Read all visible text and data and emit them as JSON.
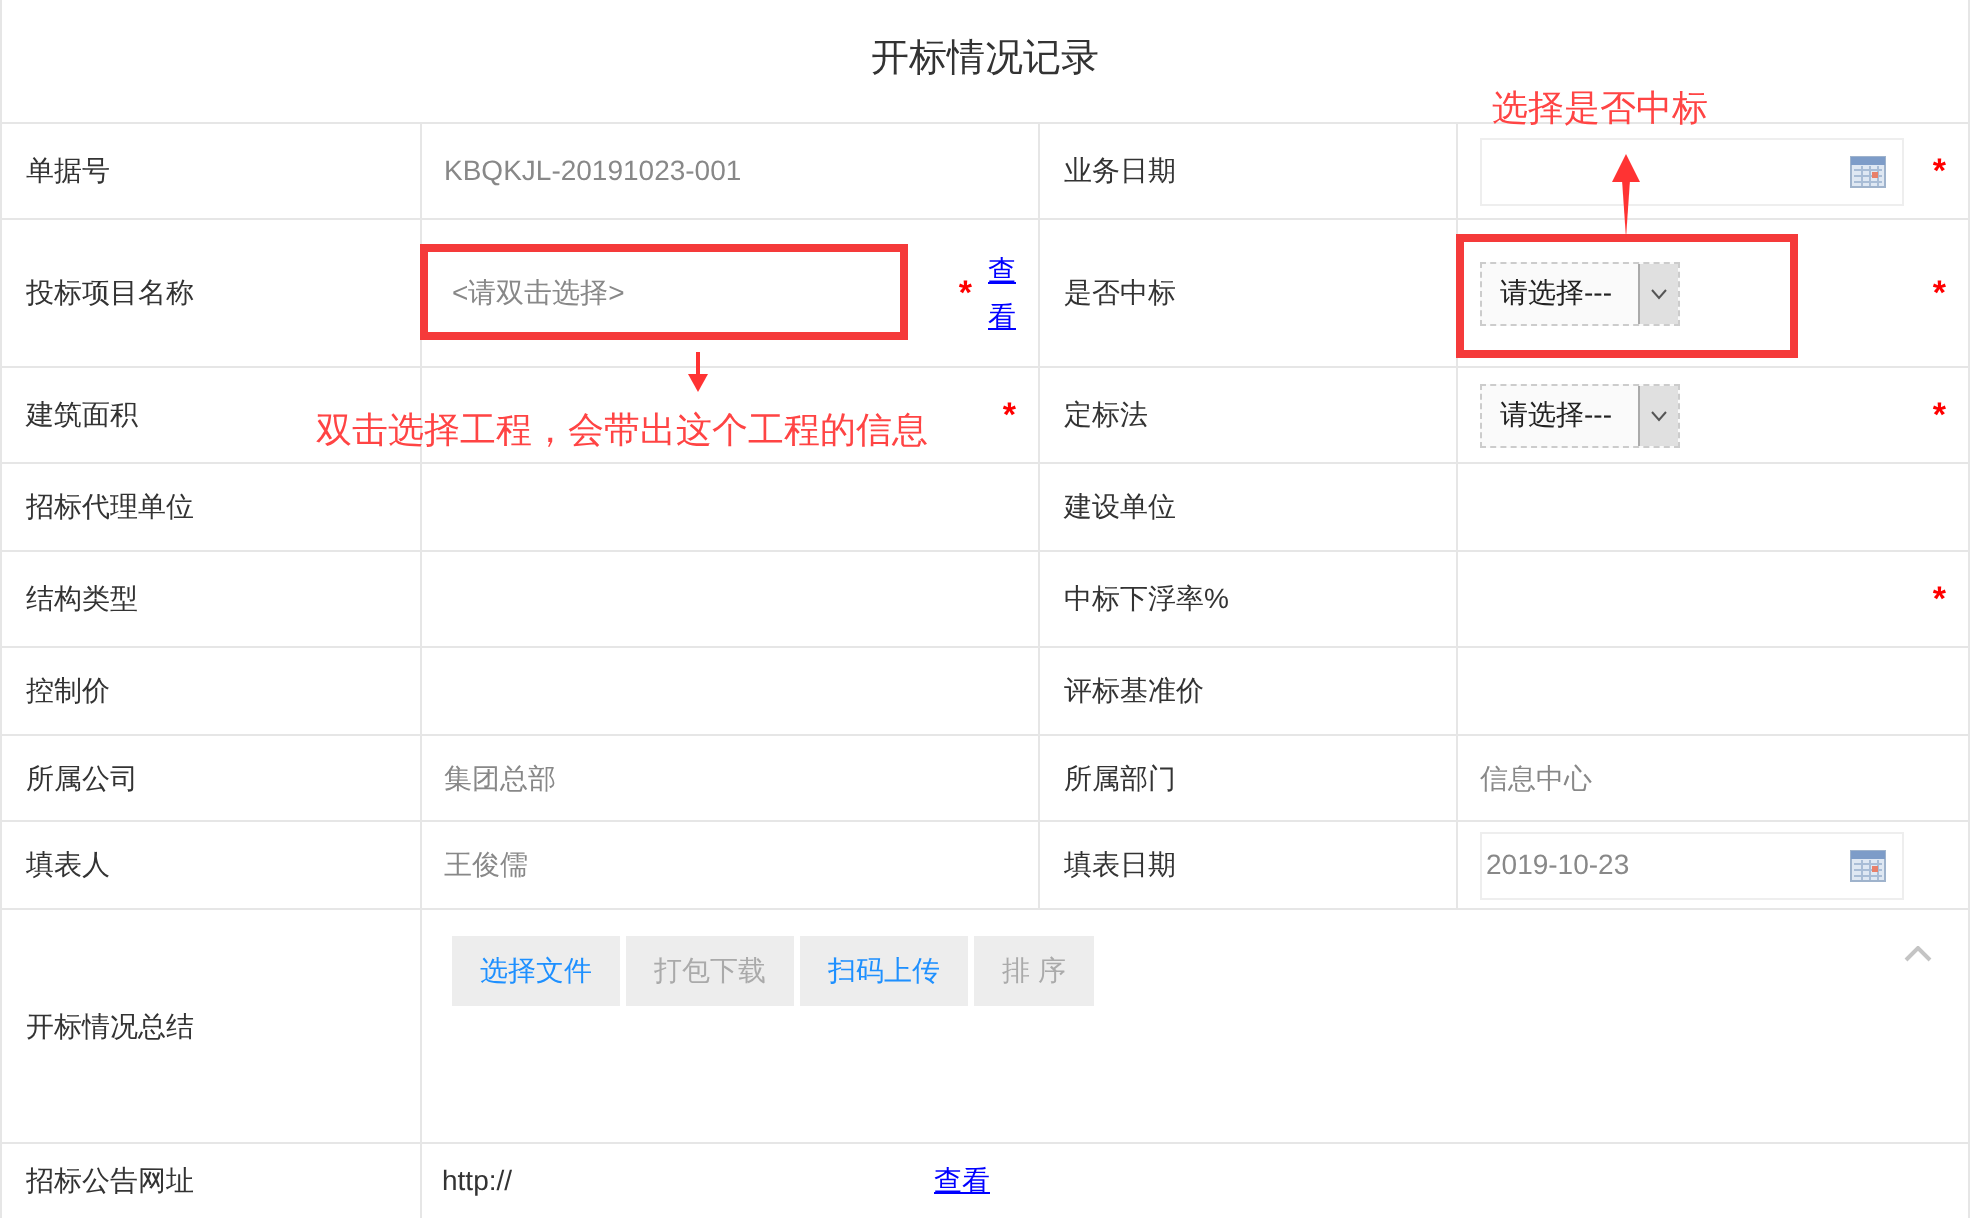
{
  "title": "开标情况记录",
  "rows": [
    {
      "fields": [
        {
          "label": "单据号",
          "kind": "text",
          "value": "KBQKJL-20191023-001"
        },
        {
          "label": "业务日期",
          "kind": "date",
          "mark": "*"
        }
      ]
    },
    {
      "fields": [
        {
          "label": "投标项目名称",
          "kind": "lookup",
          "placeholder": "<请双击选择>",
          "mark": "*",
          "link": "查看",
          "callout": {
            "text": "双击选择工程，会带出这个工程的信息",
            "kind": "arrow-down"
          }
        },
        {
          "label": "是否中标",
          "kind": "select",
          "value": "请选择---",
          "mark": "*",
          "callout": {
            "text": "选择是否中标",
            "kind": "arrow-up"
          }
        }
      ]
    },
    {
      "fields": [
        {
          "label": "建筑面积",
          "kind": "empty",
          "mark": "*"
        },
        {
          "label": "定标法",
          "kind": "select",
          "value": "请选择---",
          "mark": "*"
        }
      ]
    },
    {
      "fields": [
        {
          "label": "招标代理单位",
          "kind": "empty"
        },
        {
          "label": "建设单位",
          "kind": "empty"
        }
      ]
    },
    {
      "fields": [
        {
          "label": "结构类型",
          "kind": "empty"
        },
        {
          "label": "中标下浮率%",
          "kind": "empty",
          "mark": "*"
        }
      ]
    },
    {
      "fields": [
        {
          "label": "控制价",
          "kind": "empty"
        },
        {
          "label": "评标基准价",
          "kind": "empty"
        }
      ]
    },
    {
      "fields": [
        {
          "label": "所属公司",
          "kind": "text",
          "value": "集团总部"
        },
        {
          "label": "所属部门",
          "kind": "text",
          "value": "信息中心"
        }
      ]
    },
    {
      "fields": [
        {
          "label": "填表人",
          "kind": "text",
          "value": "王俊儒"
        },
        {
          "label": "填表日期",
          "kind": "date",
          "value": "2019-10-23"
        }
      ]
    }
  ],
  "attachments": {
    "label": "开标情况总结",
    "expanded": true,
    "buttons": [
      {
        "label": "选择文件",
        "disabled": false
      },
      {
        "label": "打包下载",
        "disabled": true
      },
      {
        "label": "扫码上传",
        "disabled": false
      },
      {
        "label": "排 序",
        "disabled": true
      }
    ]
  },
  "url_row": {
    "label": "招标公告网址",
    "value": "http://",
    "link": "查看"
  }
}
